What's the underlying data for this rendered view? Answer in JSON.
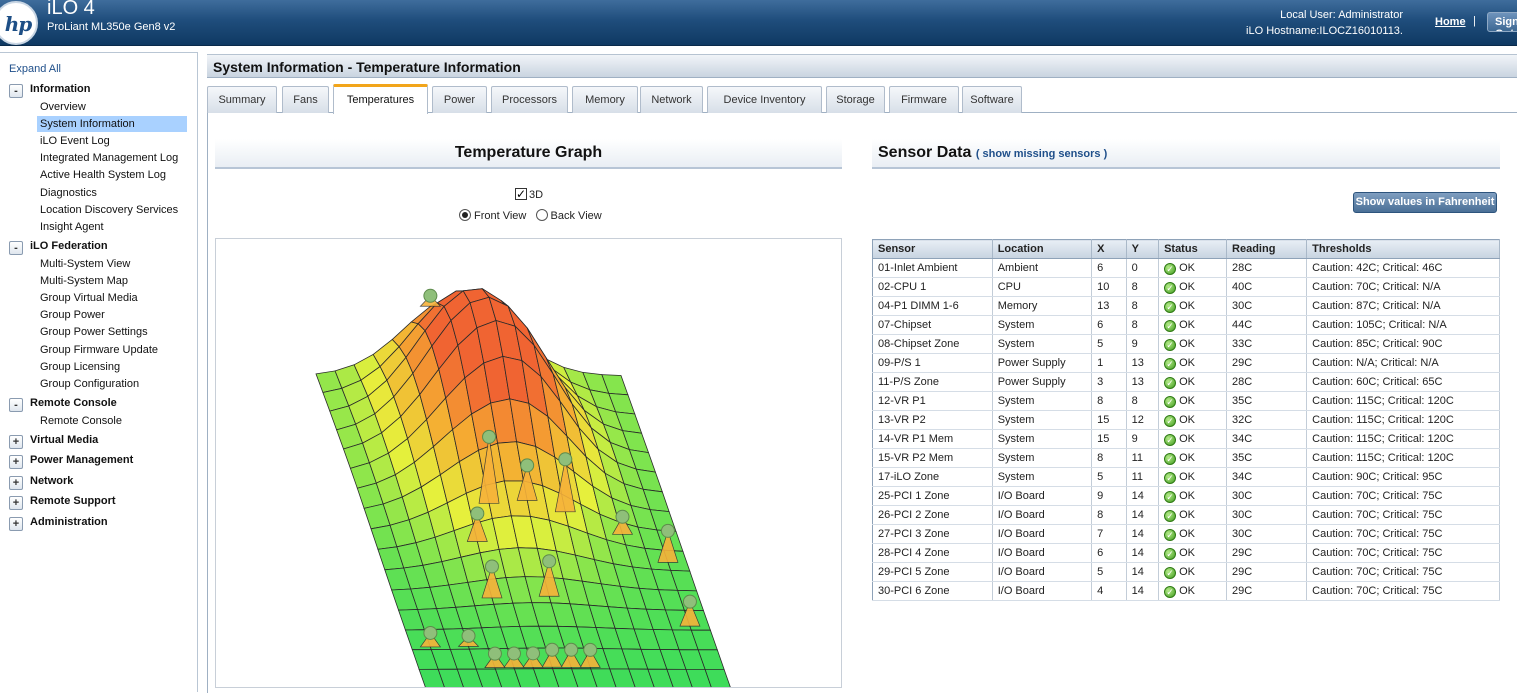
{
  "header": {
    "logo": "hp",
    "title": "iLO 4",
    "subtitle": "ProLiant ML350e Gen8 v2",
    "user_line": "Local User:  Administrator",
    "host_line": "iLO Hostname:ILOCZ16010113.",
    "home": "Home",
    "separator": "|",
    "signout": "Sign Out"
  },
  "sidebar": {
    "expand_all": "Expand All",
    "sections": [
      {
        "toggle": "-",
        "label": "Information",
        "items": [
          "Overview",
          "System Information",
          "iLO Event Log",
          "Integrated Management Log",
          "Active Health System Log",
          "Diagnostics",
          "Location Discovery Services",
          "Insight Agent"
        ]
      },
      {
        "toggle": "-",
        "label": "iLO Federation",
        "items": [
          "Multi-System View",
          "Multi-System Map",
          "Group Virtual Media",
          "Group Power",
          "Group Power Settings",
          "Group Firmware Update",
          "Group Licensing",
          "Group Configuration"
        ]
      },
      {
        "toggle": "-",
        "label": "Remote Console",
        "items": [
          "Remote Console"
        ]
      },
      {
        "toggle": "+",
        "label": "Virtual Media",
        "items": []
      },
      {
        "toggle": "+",
        "label": "Power Management",
        "items": []
      },
      {
        "toggle": "+",
        "label": "Network",
        "items": []
      },
      {
        "toggle": "+",
        "label": "Remote Support",
        "items": []
      },
      {
        "toggle": "+",
        "label": "Administration",
        "items": []
      }
    ],
    "active_item": "System Information"
  },
  "main": {
    "page_title": "System Information - Temperature Information",
    "tabs": [
      "Summary",
      "Fans",
      "Temperatures",
      "Power",
      "Processors",
      "Memory",
      "Network",
      "Device Inventory",
      "Storage",
      "Firmware",
      "Software"
    ],
    "active_tab": "Temperatures",
    "graph": {
      "title": "Temperature Graph",
      "option_3d": "3D",
      "option_3d_checked": true,
      "front_view": "Front View",
      "back_view": "Back View",
      "selected_view": "Front View"
    },
    "sensors": {
      "title": "Sensor Data",
      "missing_link": "( show missing sensors )",
      "fahrenheit_button": "Show values in Fahrenheit",
      "columns": [
        "Sensor",
        "Location",
        "X",
        "Y",
        "Status",
        "Reading",
        "Thresholds"
      ],
      "rows": [
        [
          "01-Inlet Ambient",
          "Ambient",
          "6",
          "0",
          "OK",
          "28C",
          "Caution: 42C; Critical: 46C"
        ],
        [
          "02-CPU 1",
          "CPU",
          "10",
          "8",
          "OK",
          "40C",
          "Caution: 70C; Critical: N/A"
        ],
        [
          "04-P1 DIMM 1-6",
          "Memory",
          "13",
          "8",
          "OK",
          "30C",
          "Caution: 87C; Critical: N/A"
        ],
        [
          "07-Chipset",
          "System",
          "6",
          "8",
          "OK",
          "44C",
          "Caution: 105C; Critical: N/A"
        ],
        [
          "08-Chipset Zone",
          "System",
          "5",
          "9",
          "OK",
          "33C",
          "Caution: 85C; Critical: 90C"
        ],
        [
          "09-P/S 1",
          "Power Supply",
          "1",
          "13",
          "OK",
          "29C",
          "Caution: N/A; Critical: N/A"
        ],
        [
          "11-P/S Zone",
          "Power Supply",
          "3",
          "13",
          "OK",
          "28C",
          "Caution: 60C; Critical: 65C"
        ],
        [
          "12-VR P1",
          "System",
          "8",
          "8",
          "OK",
          "35C",
          "Caution: 115C; Critical: 120C"
        ],
        [
          "13-VR P2",
          "System",
          "15",
          "12",
          "OK",
          "32C",
          "Caution: 115C; Critical: 120C"
        ],
        [
          "14-VR P1 Mem",
          "System",
          "15",
          "9",
          "OK",
          "34C",
          "Caution: 115C; Critical: 120C"
        ],
        [
          "15-VR P2 Mem",
          "System",
          "8",
          "11",
          "OK",
          "35C",
          "Caution: 115C; Critical: 120C"
        ],
        [
          "17-iLO Zone",
          "System",
          "5",
          "11",
          "OK",
          "34C",
          "Caution: 90C; Critical: 95C"
        ],
        [
          "25-PCI 1 Zone",
          "I/O Board",
          "9",
          "14",
          "OK",
          "30C",
          "Caution: 70C; Critical: 75C"
        ],
        [
          "26-PCI 2 Zone",
          "I/O Board",
          "8",
          "14",
          "OK",
          "30C",
          "Caution: 70C; Critical: 75C"
        ],
        [
          "27-PCI 3 Zone",
          "I/O Board",
          "7",
          "14",
          "OK",
          "30C",
          "Caution: 70C; Critical: 75C"
        ],
        [
          "28-PCI 4 Zone",
          "I/O Board",
          "6",
          "14",
          "OK",
          "29C",
          "Caution: 70C; Critical: 75C"
        ],
        [
          "29-PCI 5 Zone",
          "I/O Board",
          "5",
          "14",
          "OK",
          "29C",
          "Caution: 70C; Critical: 75C"
        ],
        [
          "30-PCI 6 Zone",
          "I/O Board",
          "4",
          "14",
          "OK",
          "29C",
          "Caution: 70C; Critical: 75C"
        ]
      ]
    }
  },
  "colors": {
    "header_blue": "#1f4d7c",
    "active_nav": "#a9d1ff",
    "tab_accent": "#f2a51a",
    "ok_green": "#3e9a1c"
  },
  "icons": {
    "logo": "hp-logo",
    "toggle_expanded": "minus-icon",
    "toggle_collapsed": "plus-icon",
    "status_ok": "check-circle-icon"
  }
}
